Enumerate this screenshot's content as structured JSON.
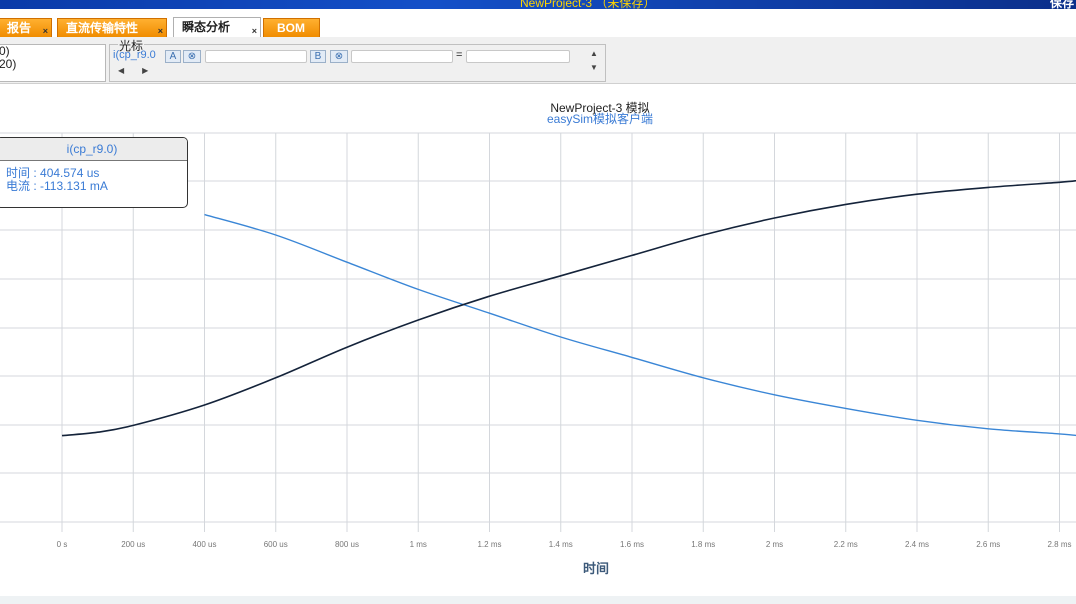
{
  "window": {
    "title": "NewProject-3 （未保存）",
    "right_label": "保存"
  },
  "tabs": [
    {
      "label": "报告",
      "active": false,
      "close": "×"
    },
    {
      "label": "直流传输特性",
      "active": false,
      "close": "×"
    },
    {
      "label": "瞬态分析",
      "active": true,
      "close": "×"
    },
    {
      "label": "BOM",
      "active": false,
      "close": ""
    }
  ],
  "left_panel": {
    "lines": [
      "0)",
      "20)"
    ]
  },
  "cursor_panel": {
    "legend": "光标",
    "trace": "i(cp_r9.0",
    "btn_a": "A",
    "btn_b": "B",
    "clear": "⊗",
    "equals": "=",
    "arrow_left": "◀",
    "arrow_right": "▶",
    "scroll_up": "▲",
    "scroll_down": "▼"
  },
  "tooltip": {
    "title": "i(cp_r9.0)",
    "time_label": "时间",
    "time_value": "404.574 us",
    "current_label": "电流",
    "current_value": "-113.131 mA"
  },
  "colors": {
    "series_blue": "#3a86d6",
    "series_dark": "#14233a",
    "grid": "#d4d7dc",
    "tab_orange": "#f39a12"
  },
  "chart_data": {
    "type": "line",
    "title": "NewProject-3 模拟",
    "subtitle": "easySim模拟客户端",
    "xlabel": "时间",
    "ylabel": "",
    "x_ticks": [
      "0 s",
      "200 us",
      "400 us",
      "600 us",
      "800 us",
      "1 ms",
      "1.2 ms",
      "1.4 ms",
      "1.6 ms",
      "1.8 ms",
      "2 ms",
      "2.2 ms",
      "2.4 ms",
      "2.6 ms",
      "2.8 ms"
    ],
    "xlim_ms": [
      0,
      2.85
    ],
    "series": [
      {
        "color": "#3a86d6",
        "x_ms": [
          0.4,
          0.6,
          0.8,
          1.0,
          1.2,
          1.4,
          1.6,
          1.8,
          2.0,
          2.2,
          2.4,
          2.6,
          2.8,
          2.85
        ],
        "y_rel": [
          0.76,
          0.7,
          0.62,
          0.54,
          0.47,
          0.4,
          0.34,
          0.28,
          0.23,
          0.19,
          0.155,
          0.13,
          0.115,
          0.11
        ]
      },
      {
        "color": "#14233a",
        "x_ms": [
          0,
          0.1,
          0.2,
          0.4,
          0.6,
          0.8,
          1.0,
          1.2,
          1.4,
          1.6,
          1.8,
          2.0,
          2.2,
          2.4,
          2.6,
          2.8,
          2.85
        ],
        "y_rel": [
          0.11,
          0.12,
          0.14,
          0.2,
          0.28,
          0.37,
          0.45,
          0.52,
          0.58,
          0.64,
          0.7,
          0.75,
          0.79,
          0.82,
          0.84,
          0.855,
          0.86
        ]
      }
    ]
  }
}
